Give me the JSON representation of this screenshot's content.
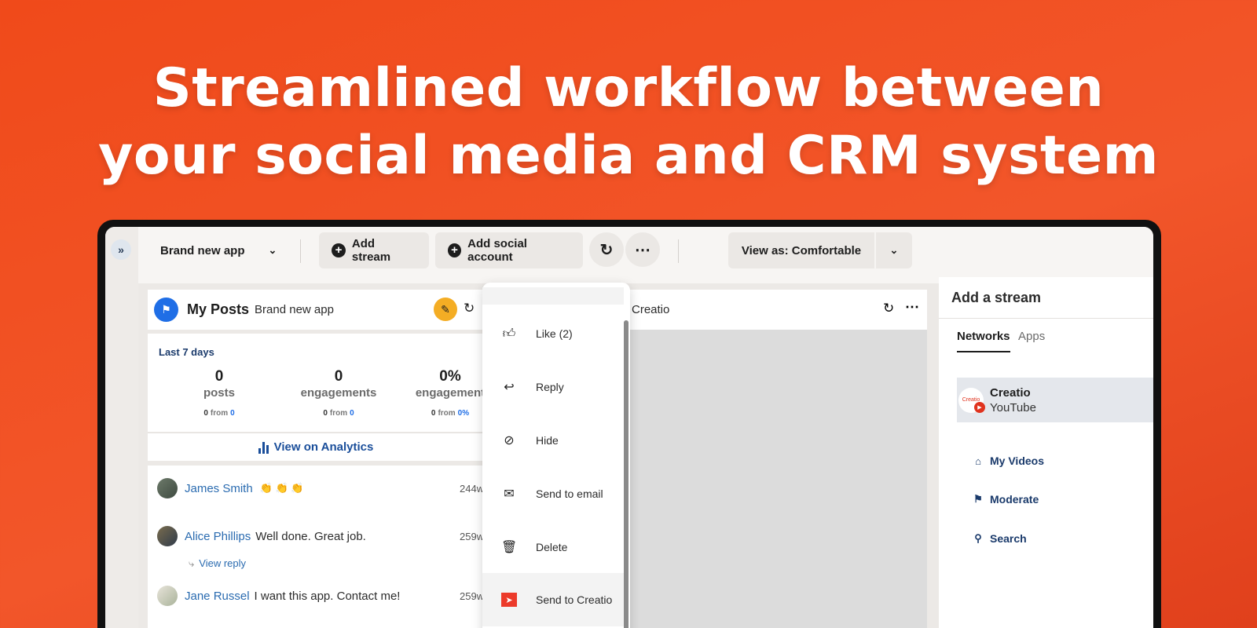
{
  "headline": {
    "line1": "Streamlined workflow between",
    "line2": "your social media and CRM system"
  },
  "toolbar": {
    "expand_glyph": "»",
    "app_name": "Brand new app",
    "add_stream": "Add stream",
    "add_social_account": "Add social account",
    "view_as": "View as: Comfortable"
  },
  "stream": {
    "title": "My Posts",
    "subtitle": "Brand new app",
    "period": "Last 7 days",
    "stats": [
      {
        "value": "0",
        "label": "posts",
        "prev": "0",
        "from_label": "from",
        "base": "0"
      },
      {
        "value": "0",
        "label": "engagements",
        "prev": "0",
        "from_label": "from",
        "base": "0"
      },
      {
        "value": "0%",
        "label": "engagement",
        "prev": "0",
        "from_label": "from",
        "base": "0%"
      }
    ],
    "analytics_link": "View on Analytics",
    "posts": [
      {
        "author": "James Smith",
        "text": "👏 👏 👏",
        "time": "244w"
      },
      {
        "author": "Alice Phillips",
        "text": "Well done. Great job.",
        "time": "259w"
      },
      {
        "author": "Jane Russel",
        "text": "I want this app. Contact me!",
        "time": "259w"
      }
    ],
    "view_reply": "View reply"
  },
  "second_stream": {
    "title": "Creatio"
  },
  "context_menu": {
    "items": [
      "Like (2)",
      "Reply",
      "Hide",
      "Send to email",
      "Delete",
      "Send to Creatio"
    ]
  },
  "add_stream_panel": {
    "title": "Add a stream",
    "tabs": [
      "Networks",
      "Apps"
    ],
    "account": {
      "name": "Creatio",
      "network": "YouTube",
      "logo_text": "Creatio"
    },
    "options": [
      "My Videos",
      "Moderate",
      "Search"
    ]
  },
  "colors": {
    "background": "#f04a1a",
    "brand_blue": "#1f6ee6",
    "compose_yellow": "#f4ad24",
    "creatio_red": "#ec3a2a"
  }
}
